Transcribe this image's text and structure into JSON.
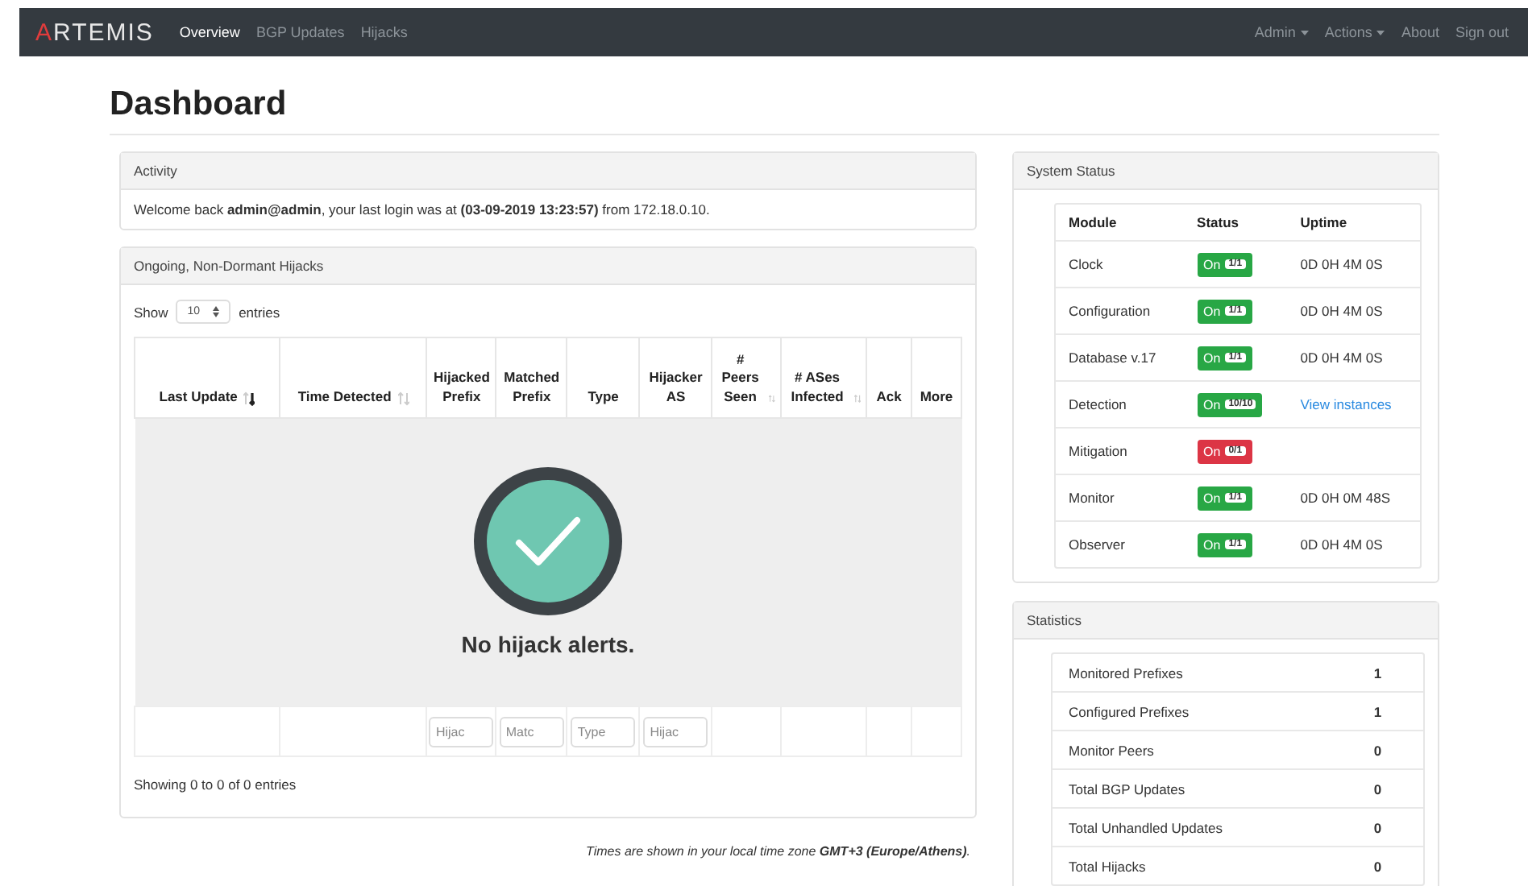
{
  "navbar": {
    "logo": "ARTEMIS",
    "links": [
      {
        "label": "Overview",
        "selected": true
      },
      {
        "label": "BGP Updates",
        "selected": false
      },
      {
        "label": "Hijacks",
        "selected": false
      }
    ],
    "right": [
      {
        "label": "Admin",
        "dropdown": true
      },
      {
        "label": "Actions",
        "dropdown": true
      },
      {
        "label": "About",
        "dropdown": false
      },
      {
        "label": "Sign out",
        "dropdown": false
      }
    ]
  },
  "title": "Dashboard",
  "activity": {
    "title": "Activity",
    "message": "Welcome back **admin@admin**, your last login was at **(03-09-2019 13:23:57)** from 172.18.0.10."
  },
  "hijacks": {
    "title": "Ongoing, Non-Dormant Hijacks",
    "show_label": "Show",
    "page_size": "10",
    "entries_label": "entries",
    "columns": [
      {
        "label": "Last Update",
        "sortable": true,
        "sorted": true
      },
      {
        "label": "Time Detected",
        "sortable": true,
        "sorted": false
      },
      {
        "label": "Hijacked Prefix",
        "sortable": false,
        "filter": {
          "placeholder": "Hijac"
        }
      },
      {
        "label": "Matched Prefix",
        "sortable": false,
        "filter": {
          "placeholder": "Matc"
        }
      },
      {
        "label": "Type",
        "sortable": false,
        "filter": {
          "placeholder": "Type"
        }
      },
      {
        "label": "Hijacker AS",
        "sortable": false,
        "filter": {
          "placeholder": "Hijac"
        }
      },
      {
        "label": "# Peers Seen",
        "sortable": true,
        "sorted": false
      },
      {
        "label": "# ASes Infected",
        "sortable": true,
        "sorted": false
      },
      {
        "label": "Ack",
        "sortable": false
      },
      {
        "label": "More",
        "sortable": false
      }
    ],
    "empty_message": "No hijack alerts.",
    "info": "Showing 0 to 0 of 0 entries"
  },
  "timezone_note": "Times are shown in your local time zone **GMT+3 (Europe/Athens)**.",
  "system_status": {
    "title": "System Status",
    "columns": [
      "Module",
      "Status",
      "Uptime"
    ],
    "rows": [
      {
        "module": "Clock",
        "status": "On",
        "count": "1/1",
        "ok": true,
        "uptime": "0D 0H 4M 0S",
        "uptime_link": false
      },
      {
        "module": "Configuration",
        "status": "On",
        "count": "1/1",
        "ok": true,
        "uptime": "0D 0H 4M 0S",
        "uptime_link": false
      },
      {
        "module": "Database v.17",
        "status": "On",
        "count": "1/1",
        "ok": true,
        "uptime": "0D 0H 4M 0S",
        "uptime_link": false
      },
      {
        "module": "Detection",
        "status": "On",
        "count": "10/10",
        "ok": true,
        "uptime": "View instances",
        "uptime_link": true
      },
      {
        "module": "Mitigation",
        "status": "On",
        "count": "0/1",
        "ok": false
      },
      {
        "module": "Monitor",
        "status": "On",
        "count": "1/1",
        "ok": true,
        "uptime": "0D 0H 0M 48S",
        "uptime_link": false
      },
      {
        "module": "Observer",
        "status": "On",
        "count": "1/1",
        "ok": true,
        "uptime": "0D 0H 4M 0S",
        "uptime_link": false
      }
    ]
  },
  "statistics": {
    "title": "Statistics",
    "rows": [
      {
        "label": "Monitored Prefixes",
        "value": "1"
      },
      {
        "label": "Configured Prefixes",
        "value": "1"
      },
      {
        "label": "Monitor Peers",
        "value": "0"
      },
      {
        "label": "Total BGP Updates",
        "value": "0"
      },
      {
        "label": "Total Unhandled Updates",
        "value": "0"
      },
      {
        "label": "Total Hijacks",
        "value": "0"
      }
    ]
  }
}
